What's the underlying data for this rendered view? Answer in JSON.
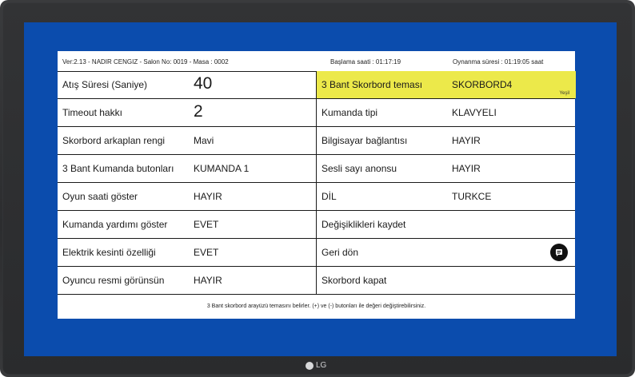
{
  "header": {
    "version_info": "Ver:2.13 - NADIR CENGIZ - Salon No: 0019 - Masa : 0002",
    "start_time": "Başlama saati :   01:17:19",
    "play_duration": "Oynanma süresi : 01:19:05 saat"
  },
  "settings": {
    "left": [
      {
        "label": "Atış Süresi (Saniye)",
        "value": "40"
      },
      {
        "label": "Timeout hakkı",
        "value": "2"
      },
      {
        "label": "Skorbord arkaplan rengi",
        "value": "Mavi"
      },
      {
        "label": "3 Bant Kumanda butonları",
        "value": "KUMANDA 1"
      },
      {
        "label": "Oyun saati göster",
        "value": "HAYIR"
      },
      {
        "label": "Kumanda yardımı göster",
        "value": "EVET"
      },
      {
        "label": "Elektrik kesinti özelliği",
        "value": "EVET"
      },
      {
        "label": "Oyuncu resmi görünsün",
        "value": "HAYIR"
      }
    ],
    "right": [
      {
        "label": "3 Bant Skorbord teması",
        "value": "SKORBORD4",
        "sub": "Yeşil"
      },
      {
        "label": "Kumanda tipi",
        "value": "KLAVYELI"
      },
      {
        "label": "Bilgisayar bağlantısı",
        "value": "HAYIR"
      },
      {
        "label": "Sesli sayı anonsu",
        "value": "HAYIR"
      },
      {
        "label": "DİL",
        "value": "TURKCE"
      },
      {
        "label": "Değişiklikleri kaydet",
        "value": ""
      },
      {
        "label": "Geri dön",
        "value": ""
      },
      {
        "label": "Skorbord kapat",
        "value": ""
      }
    ]
  },
  "footer": {
    "help_text": "3 Bant skorbord arayüzü temasını belirler.  (+) ve (-) butonları ile değeri değiştirebilirsiniz."
  },
  "monitor": {
    "brand": "LG"
  },
  "colors": {
    "screen_bg": "#0b4cad",
    "highlight": "#ece94a"
  },
  "icons": {
    "chat": "chat-bubble-icon"
  }
}
